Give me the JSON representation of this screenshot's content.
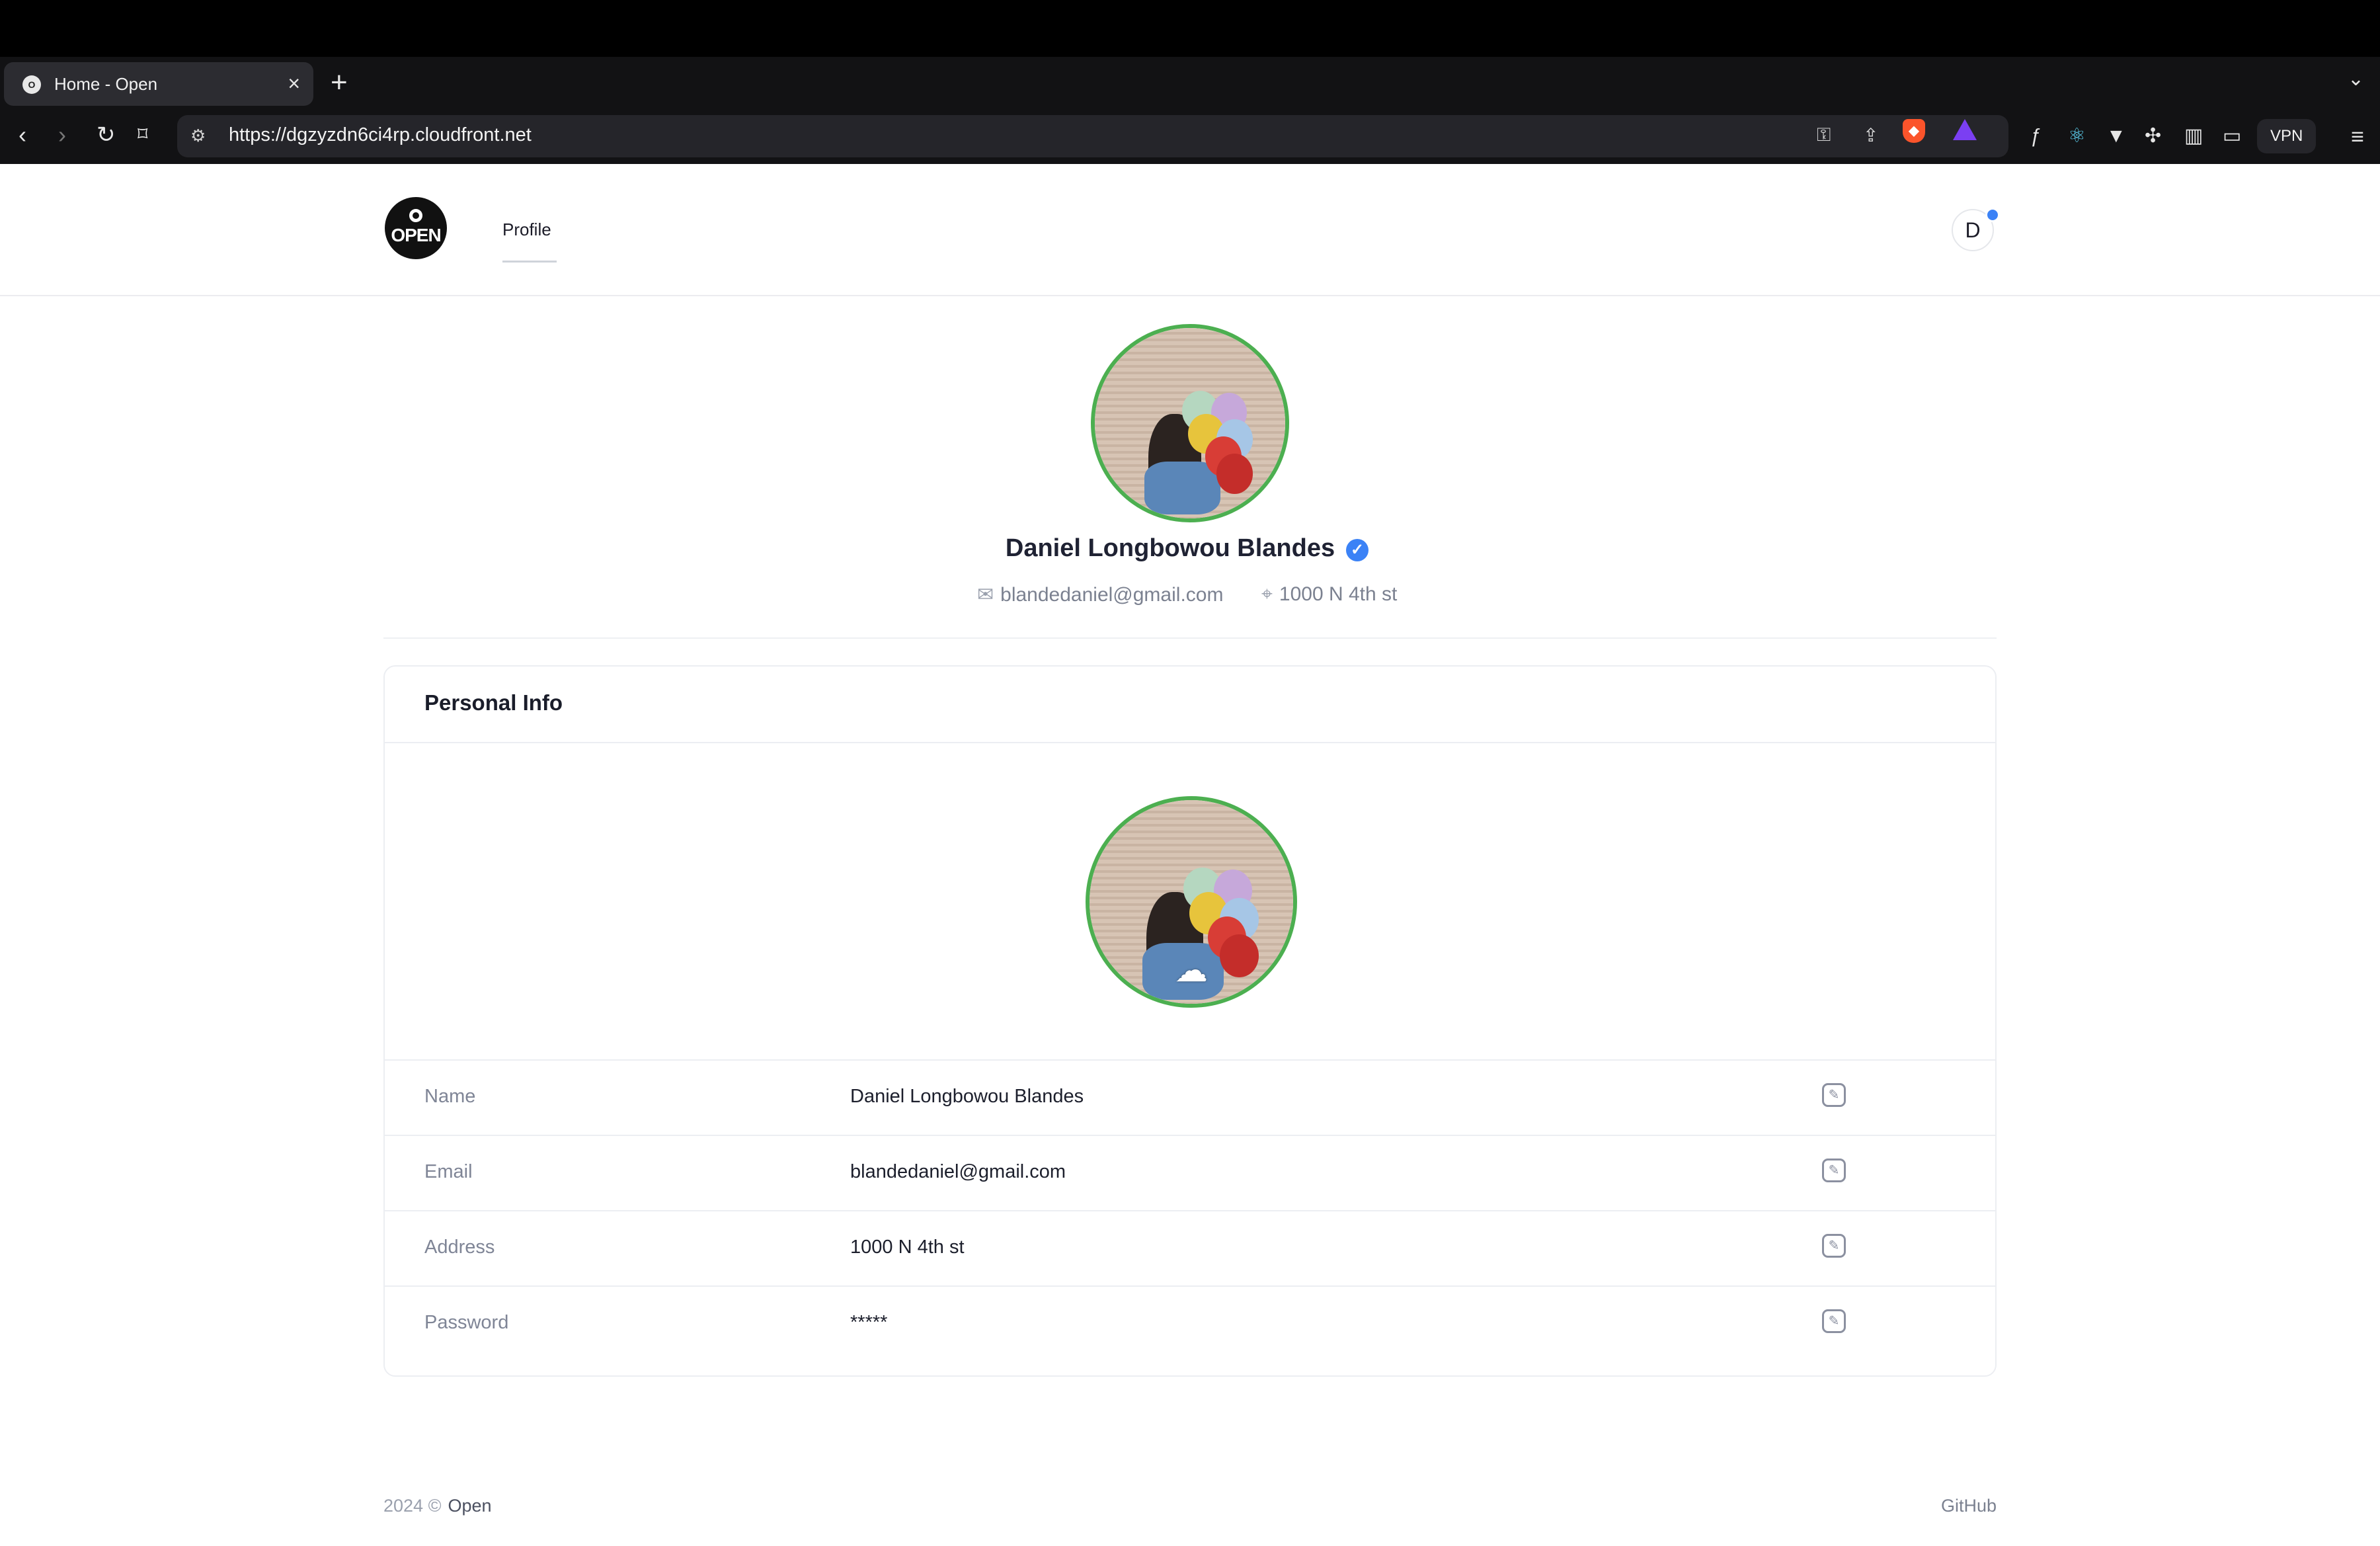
{
  "browser": {
    "tab_title": "Home - Open",
    "url": "https://dgzyzdn6ci4rp.cloudfront.net",
    "vpn_label": "VPN",
    "toolbar_icons": [
      "back-icon",
      "forward-icon",
      "reload-icon",
      "bookmark-icon",
      "key-icon",
      "share-icon",
      "brave-shield-icon",
      "brave-rewards-icon",
      "extension-fx-icon",
      "react-devtools-icon",
      "vue-icon",
      "extensions-icon",
      "sidebar-icon",
      "wallet-icon",
      "menu-icon"
    ]
  },
  "app": {
    "nav_profile": "Profile",
    "user_initial": "D"
  },
  "profile": {
    "name": "Daniel Longbowou Blandes",
    "email": "blandedaniel@gmail.com",
    "address": "1000 N 4th st"
  },
  "card": {
    "title": "Personal Info",
    "rows": [
      {
        "label": "Name",
        "value": "Daniel Longbowou Blandes"
      },
      {
        "label": "Email",
        "value": "blandedaniel@gmail.com"
      },
      {
        "label": "Address",
        "value": "1000 N 4th st"
      },
      {
        "label": "Password",
        "value": "*****"
      }
    ]
  },
  "footer": {
    "copyright": "2024 ©",
    "brand": "Open",
    "github": "GitHub"
  },
  "colors": {
    "accent_green": "#4caf50",
    "verified_blue": "#3b82f6"
  }
}
